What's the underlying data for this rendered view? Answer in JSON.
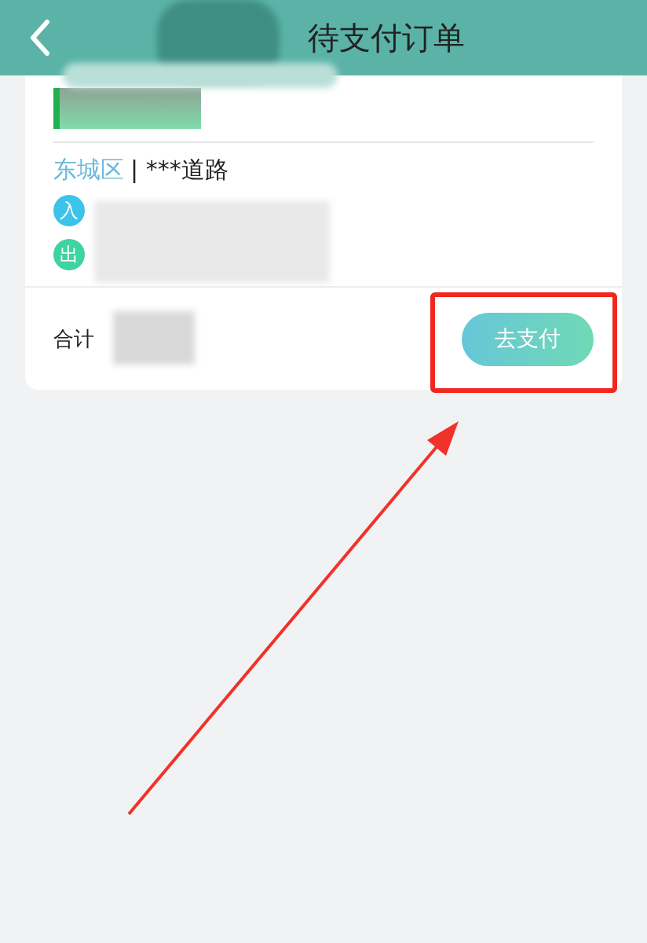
{
  "header": {
    "title": "待支付订单"
  },
  "order": {
    "district": "东城区",
    "address": "| ***道路",
    "stops": [
      {
        "kind": "in",
        "badge": "入"
      },
      {
        "kind": "out",
        "badge": "出"
      }
    ],
    "total_label": "合计",
    "pay_button": "去支付"
  }
}
